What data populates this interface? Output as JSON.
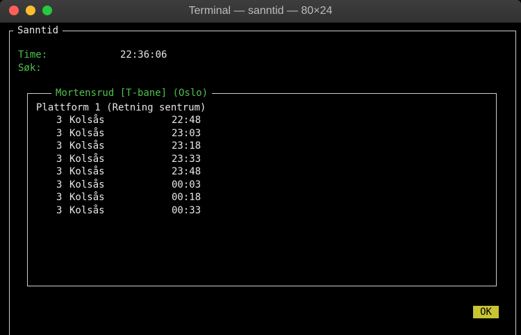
{
  "window": {
    "title": "Terminal — sanntid — 80×24"
  },
  "app": {
    "panel_title": "Sanntid",
    "time_label": "Time:",
    "time_value": "22:36:06",
    "search_label": "Søk:",
    "search_value": ""
  },
  "station": {
    "name": "Mortensrud [T-bane] (Oslo)",
    "platform": "Plattform 1 (Retning sentrum)",
    "departures": [
      {
        "line": "3",
        "destination": "Kolsås",
        "time": "22:48"
      },
      {
        "line": "3",
        "destination": "Kolsås",
        "time": "23:03"
      },
      {
        "line": "3",
        "destination": "Kolsås",
        "time": "23:18"
      },
      {
        "line": "3",
        "destination": "Kolsås",
        "time": "23:33"
      },
      {
        "line": "3",
        "destination": "Kolsås",
        "time": "23:48"
      },
      {
        "line": "3",
        "destination": "Kolsås",
        "time": "00:03"
      },
      {
        "line": "3",
        "destination": "Kolsås",
        "time": "00:18"
      },
      {
        "line": "3",
        "destination": "Kolsås",
        "time": "00:33"
      }
    ]
  },
  "actions": {
    "ok_label": "OK"
  },
  "colors": {
    "accent_green": "#4fc14f",
    "button_yellow": "#c8c432"
  }
}
